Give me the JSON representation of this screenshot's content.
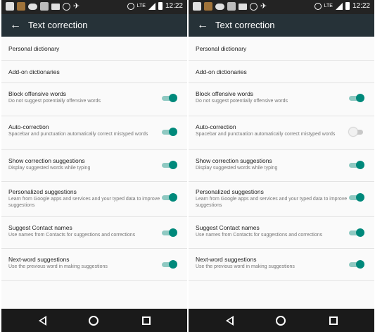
{
  "status_bar": {
    "time": "12:22",
    "network": "LTE",
    "icons": [
      "gallery-icon",
      "game-icon",
      "cloud-icon",
      "image-icon",
      "mail-icon",
      "uk-icon",
      "airplane-icon",
      "alarm-icon",
      "signal-icon",
      "battery-icon"
    ]
  },
  "app_bar": {
    "title": "Text correction",
    "back_icon": "arrow-back-icon"
  },
  "colors": {
    "app_bar": "#263238",
    "accent": "#00897b",
    "highlight": "#d9181b"
  },
  "screens": [
    {
      "items": [
        {
          "label": "Personal dictionary"
        },
        {
          "label": "Add-on dictionaries"
        },
        {
          "label": "Block offensive words",
          "summary": "Do not suggest potentially offensive words",
          "checked": true
        },
        {
          "label": "Auto-correction",
          "summary": "Spacebar and punctuation automatically correct mistyped words",
          "checked": true,
          "highlighted": true
        },
        {
          "label": "Show correction suggestions",
          "summary": "Display suggested words while typing",
          "checked": true
        },
        {
          "label": "Personalized suggestions",
          "summary": "Learn from Google apps and services and your typed data to improve suggestions",
          "checked": true
        },
        {
          "label": "Suggest Contact names",
          "summary": "Use names from Contacts for suggestions and corrections",
          "checked": true
        },
        {
          "label": "Next-word suggestions",
          "summary": "Use the previous word in making suggestions",
          "checked": true
        }
      ]
    },
    {
      "items": [
        {
          "label": "Personal dictionary"
        },
        {
          "label": "Add-on dictionaries"
        },
        {
          "label": "Block offensive words",
          "summary": "Do not suggest potentially offensive words",
          "checked": true
        },
        {
          "label": "Auto-correction",
          "summary": "Spacebar and punctuation automatically correct mistyped words",
          "checked": false
        },
        {
          "label": "Show correction suggestions",
          "summary": "Display suggested words while typing",
          "checked": true
        },
        {
          "label": "Personalized suggestions",
          "summary": "Learn from Google apps and services and your typed data to improve suggestions",
          "checked": true
        },
        {
          "label": "Suggest Contact names",
          "summary": "Use names from Contacts for suggestions and corrections",
          "checked": true
        },
        {
          "label": "Next-word suggestions",
          "summary": "Use the previous word in making suggestions",
          "checked": true
        }
      ]
    }
  ],
  "nav_bar": {
    "icons": [
      "back-triangle-icon",
      "home-circle-icon",
      "recents-square-icon"
    ]
  }
}
